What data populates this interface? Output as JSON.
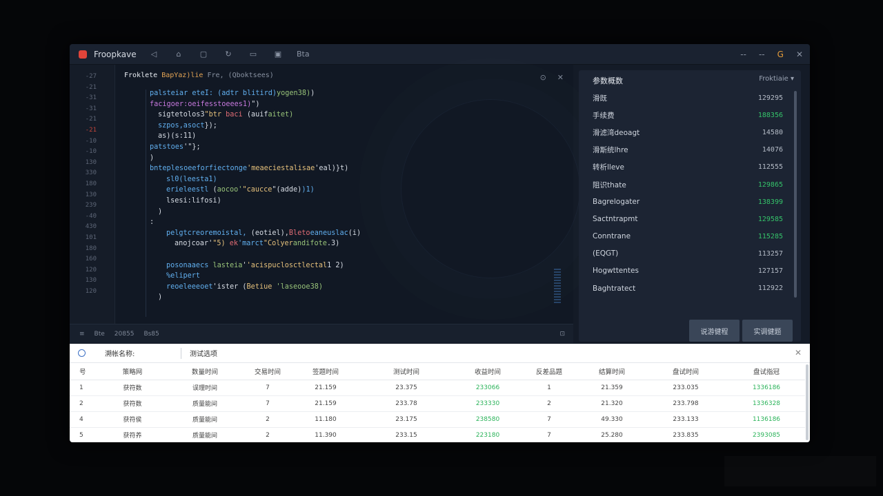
{
  "app": {
    "title": "Froopkave",
    "toolbar_icons": [
      "tab-icon",
      "home-icon",
      "square-icon",
      "refresh-icon",
      "folder-icon",
      "window-icon",
      "text-icon"
    ],
    "toolbar_text": "Bta"
  },
  "window_controls": {
    "minimize": "--",
    "restore": "--",
    "accent": "G",
    "close": "✕"
  },
  "editor": {
    "gutter": [
      "-27",
      "-21",
      "-31",
      "-31",
      "-21",
      "-21",
      "-10",
      "-10",
      "130",
      "330",
      "180",
      "130",
      "239",
      "-40",
      "430",
      "101",
      "180",
      "160",
      "120",
      "130",
      "120"
    ],
    "gutter_red_index": 5,
    "header": {
      "part1": "Froklete",
      "part2": "BapYaz)lie",
      "part3": "Fre, (Qboktsees)"
    },
    "controls": {
      "a": "⊙",
      "b": "✕"
    },
    "lines": [
      {
        "indent": 0,
        "segments": [
          [
            "b",
            "palsteiar eteI: (adtr blitird)"
          ],
          [
            "g",
            "yogen38)"
          ],
          [
            "w",
            ")"
          ]
        ]
      },
      {
        "indent": 0,
        "segments": [
          [
            "k",
            "facigoer:oeifesstoeees1)"
          ],
          [
            "w",
            "\")"
          ]
        ]
      },
      {
        "indent": 1,
        "segments": [
          [
            "w",
            "sigtetolos3"
          ],
          [
            "y",
            "\"btr"
          ],
          [
            "w",
            " "
          ],
          [
            "r",
            "baci"
          ],
          [
            "w",
            " (auif"
          ],
          [
            "g",
            "aitet)"
          ]
        ]
      },
      {
        "indent": 1,
        "segments": [
          [
            "b",
            "szpos,asoct"
          ],
          [
            "w",
            "});"
          ]
        ]
      },
      {
        "indent": 1,
        "segments": [
          [
            "w",
            "as)(s:11)"
          ]
        ]
      },
      {
        "indent": 0,
        "segments": [
          [
            "b",
            "patstoes"
          ],
          [
            "w",
            "'\"};"
          ]
        ]
      },
      {
        "indent": 0,
        "segments": [
          [
            "w",
            ")"
          ]
        ]
      },
      {
        "indent": 0,
        "segments": [
          [
            "b",
            "bnteplesoeeforfiectonge"
          ],
          [
            "y",
            "'meaeciestalisae"
          ],
          [
            "w",
            "'eal)}t)"
          ]
        ]
      },
      {
        "indent": 2,
        "segments": [
          [
            "b",
            "sl0(leesta1)"
          ]
        ]
      },
      {
        "indent": 2,
        "segments": [
          [
            "b",
            "erieleestl"
          ],
          [
            "w",
            " ("
          ],
          [
            "g",
            "aocoo'"
          ],
          [
            "y",
            "\"caucce"
          ],
          [
            "w",
            "\"(adde)"
          ],
          [
            "b",
            ")1)"
          ]
        ]
      },
      {
        "indent": 2,
        "segments": [
          [
            "w",
            "lsesi:lifosi)"
          ]
        ]
      },
      {
        "indent": 1,
        "segments": [
          [
            "w",
            ")"
          ]
        ]
      },
      {
        "indent": 0,
        "segments": [
          [
            "w",
            ":"
          ]
        ]
      },
      {
        "indent": 2,
        "segments": [
          [
            "b",
            "pelgtcreoremoistal,"
          ],
          [
            "w",
            " (eotiel),"
          ],
          [
            "r",
            "Bleto"
          ],
          [
            "b",
            "eaneuslac"
          ],
          [
            "w",
            "(i)"
          ]
        ]
      },
      {
        "indent": 3,
        "segments": [
          [
            "w",
            "anojcoar'"
          ],
          [
            "y",
            "\"5)"
          ],
          [
            "w",
            " "
          ],
          [
            "r",
            "ek"
          ],
          [
            "b",
            "'marct"
          ],
          [
            "y",
            "\"Colyer"
          ],
          [
            "g",
            "andifote"
          ],
          [
            "w",
            ".3)"
          ]
        ]
      },
      {
        "indent": 0,
        "segments": []
      },
      {
        "indent": 2,
        "segments": [
          [
            "b",
            "posonaaecs"
          ],
          [
            "w",
            " "
          ],
          [
            "g",
            "lasteia"
          ],
          [
            "w",
            "'"
          ],
          [
            "y",
            "'acispuclosctlectal"
          ],
          [
            "w",
            "1 2)"
          ]
        ]
      },
      {
        "indent": 2,
        "segments": [
          [
            "b",
            "%elipert"
          ]
        ]
      },
      {
        "indent": 2,
        "segments": [
          [
            "b",
            "reoeleeeoet"
          ],
          [
            "w",
            "'ister ("
          ],
          [
            "y",
            "Betiue"
          ],
          [
            "w",
            " "
          ],
          [
            "g",
            "'laseooe38)"
          ]
        ]
      },
      {
        "indent": 1,
        "segments": [
          [
            "w",
            ")"
          ]
        ]
      }
    ]
  },
  "statusbar": {
    "items": [
      "≡",
      "Bte",
      "20855",
      "Bs85"
    ],
    "end": "⊡"
  },
  "right_panel": {
    "title": "参数概数",
    "select": "Froktiaie",
    "rows": [
      {
        "label": "滑既",
        "value": "129295",
        "green": false
      },
      {
        "label": "手续费",
        "value": "188356",
        "green": true
      },
      {
        "label": "滑滤湾deoagt",
        "value": "14580",
        "green": false
      },
      {
        "label": "滑斯统lhre",
        "value": "14076",
        "green": false
      },
      {
        "label": "转析lleve",
        "value": "112555",
        "green": false
      },
      {
        "label": "阻识thate",
        "value": "129865",
        "green": true
      },
      {
        "label": "Bagrelogater",
        "value": "138399",
        "green": true
      },
      {
        "label": "Sactntrapmt",
        "value": "129585",
        "green": true
      },
      {
        "label": "Conntrane",
        "value": "115285",
        "green": true
      },
      {
        "label": "(EQGT)",
        "value": "113257",
        "green": false
      },
      {
        "label": "Hogwttentes",
        "value": "127157",
        "green": false
      },
      {
        "label": "Baghtratect",
        "value": "112922",
        "green": false
      }
    ],
    "buttons": [
      "说游健程",
      "实调健题"
    ]
  },
  "bottom_panel": {
    "label": "溯帐名称:",
    "tab": "测试选项",
    "close": "✕",
    "columns": [
      "号",
      "策略网",
      "数量时间",
      "交易时间",
      "签题时间",
      "测试时间",
      "收益时间",
      "反差品题",
      "结算时间",
      "盘试时间",
      "盘试指冠"
    ],
    "rows": [
      [
        "1",
        "获符数",
        "误理时间",
        "7",
        "21.159",
        "23.375",
        "233066",
        "1",
        "21.359",
        "233.035",
        "1336186"
      ],
      [
        "2",
        "获符数",
        "质量能间",
        "7",
        "21.159",
        "233.78",
        "233330",
        "2",
        "21.320",
        "233.798",
        "1336328"
      ],
      [
        "4",
        "获符侯",
        "质量能间",
        "2",
        "11.180",
        "23.175",
        "238580",
        "7",
        "49.330",
        "233.133",
        "1136186"
      ],
      [
        "5",
        "获符养",
        "质量能间",
        "2",
        "11.390",
        "233.15",
        "223180",
        "7",
        "25.280",
        "233.835",
        "2393085"
      ]
    ],
    "green_cols": [
      6,
      10
    ]
  }
}
